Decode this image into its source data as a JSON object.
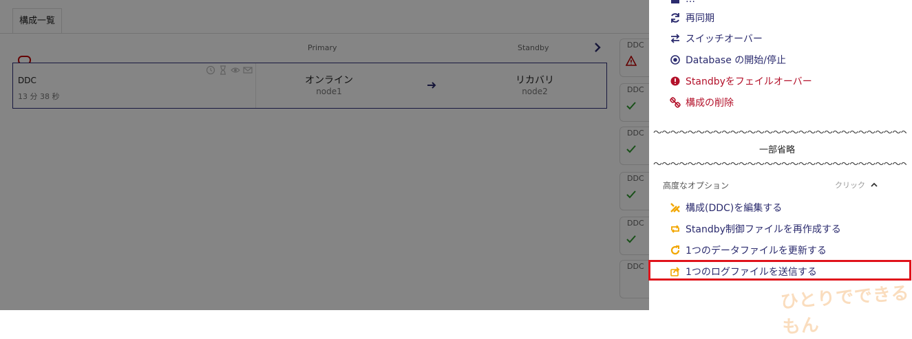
{
  "tab": {
    "label": "構成一覧"
  },
  "columns": {
    "primary": "Primary",
    "standby": "Standby"
  },
  "config": {
    "name": "DDC",
    "elapsed": "13 分 38 秒",
    "primary": {
      "status": "オンライン",
      "node": "node1"
    },
    "standby": {
      "status": "リカバリ",
      "node": "node2"
    }
  },
  "cards": [
    {
      "label": "DDC",
      "status": "warning"
    },
    {
      "label": "DDC",
      "status": "ok"
    },
    {
      "label": "DDC",
      "status": "ok"
    },
    {
      "label": "DDC",
      "status": "ok"
    },
    {
      "label": "DDC",
      "status": "ok"
    },
    {
      "label": "DDC",
      "status": "ok"
    }
  ],
  "menu": {
    "top_cut": "…",
    "resync": "再同期",
    "switchover": "スイッチオーバー",
    "db_start_stop": "Database の開始/停止",
    "failover": "Standbyをフェイルオーバー",
    "delete": "構成の削除",
    "wave": "〜〜〜〜〜〜〜〜〜〜〜〜〜〜〜〜〜〜〜〜〜〜〜〜〜〜〜〜〜〜〜〜〜〜〜〜",
    "omitted": "一部省略",
    "advanced": "高度なオプション",
    "click_hint": "クリック",
    "edit_config": "構成(DDC)を編集する",
    "recreate_standby_ctl": "Standby制御ファイルを再作成する",
    "refresh_datafile": "1つのデータファイルを更新する",
    "send_logfile": "1つのログファイルを送信する"
  },
  "watermark": "ひとりでできるもん",
  "colors": {
    "accent": "#2b2b6e",
    "danger": "#b3112a",
    "warning": "#f2a600",
    "highlight": "#e0121b",
    "ok": "#2e9a2e"
  }
}
